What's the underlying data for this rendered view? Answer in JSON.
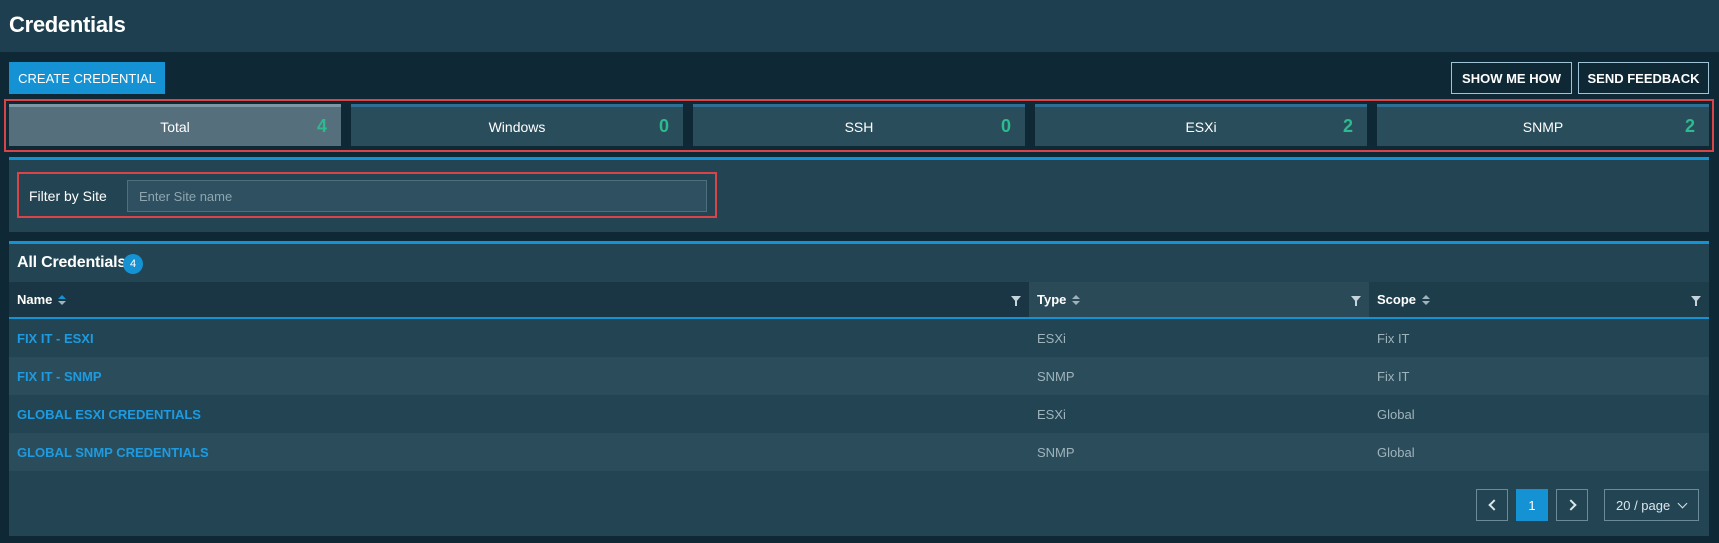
{
  "header": {
    "title": "Credentials"
  },
  "toolbar": {
    "create_label": "CREATE CREDENTIAL",
    "show_me_how_label": "SHOW ME HOW",
    "send_feedback_label": "SEND FEEDBACK"
  },
  "stats": [
    {
      "label": "Total",
      "count": "4",
      "active": true
    },
    {
      "label": "Windows",
      "count": "0",
      "active": false
    },
    {
      "label": "SSH",
      "count": "0",
      "active": false
    },
    {
      "label": "ESXi",
      "count": "2",
      "active": false
    },
    {
      "label": "SNMP",
      "count": "2",
      "active": false
    }
  ],
  "filter": {
    "label": "Filter by Site",
    "value": "",
    "placeholder": "Enter Site name"
  },
  "list": {
    "title": "All Credentials",
    "count": "4",
    "columns": [
      {
        "label": "Name"
      },
      {
        "label": "Type"
      },
      {
        "label": "Scope"
      }
    ],
    "rows": [
      {
        "name": "FIX IT - ESXI",
        "type": "ESXi",
        "scope": "Fix IT"
      },
      {
        "name": "FIX IT - SNMP",
        "type": "SNMP",
        "scope": "Fix IT"
      },
      {
        "name": "GLOBAL ESXI CREDENTIALS",
        "type": "ESXi",
        "scope": "Global"
      },
      {
        "name": "GLOBAL SNMP CREDENTIALS",
        "type": "SNMP",
        "scope": "Global"
      }
    ]
  },
  "pagination": {
    "current_page": "1",
    "page_size": "20 / page"
  },
  "colors": {
    "accent": "#1592d4",
    "count_green": "#2bbb8f",
    "highlight_red": "#d84447"
  },
  "icons": [
    "sort-icon",
    "filter-icon",
    "chevron-left-icon",
    "chevron-right-icon",
    "chevron-down-icon"
  ]
}
